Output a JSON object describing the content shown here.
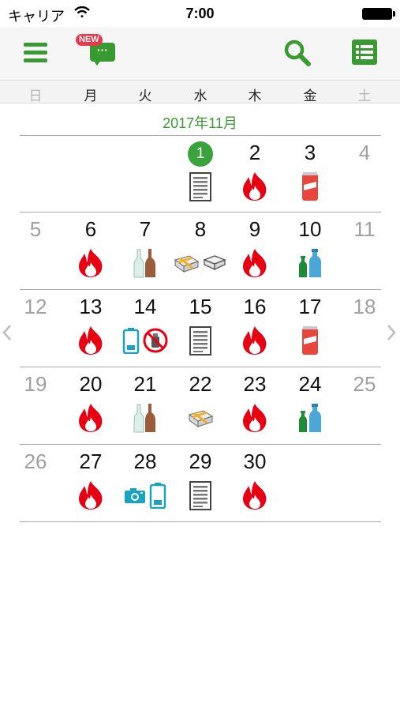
{
  "status_bar": {
    "carrier": "キャリア",
    "time": "7:00"
  },
  "toolbar": {
    "new_badge": "NEW",
    "bubble_text": "···"
  },
  "weekdays": [
    "日",
    "月",
    "火",
    "水",
    "木",
    "金",
    "土"
  ],
  "calendar": {
    "title": "2017年11月",
    "weeks": [
      [
        {
          "d": "",
          "i": []
        },
        {
          "d": "",
          "i": []
        },
        {
          "d": "",
          "i": []
        },
        {
          "d": "1",
          "i": [
            "paper"
          ],
          "today": true
        },
        {
          "d": "2",
          "i": [
            "burnable"
          ]
        },
        {
          "d": "3",
          "i": [
            "can"
          ]
        },
        {
          "d": "4",
          "i": []
        }
      ],
      [
        {
          "d": "5",
          "i": []
        },
        {
          "d": "6",
          "i": [
            "burnable"
          ]
        },
        {
          "d": "7",
          "i": [
            "bottles"
          ]
        },
        {
          "d": "8",
          "i": [
            "newspaper",
            "containers"
          ]
        },
        {
          "d": "9",
          "i": [
            "burnable"
          ]
        },
        {
          "d": "10",
          "i": [
            "pet"
          ]
        },
        {
          "d": "11",
          "i": []
        }
      ],
      [
        {
          "d": "12",
          "i": []
        },
        {
          "d": "13",
          "i": [
            "burnable"
          ]
        },
        {
          "d": "14",
          "i": [
            "battery",
            "no-spray"
          ]
        },
        {
          "d": "15",
          "i": [
            "paper"
          ]
        },
        {
          "d": "16",
          "i": [
            "burnable"
          ]
        },
        {
          "d": "17",
          "i": [
            "can"
          ]
        },
        {
          "d": "18",
          "i": []
        }
      ],
      [
        {
          "d": "19",
          "i": []
        },
        {
          "d": "20",
          "i": [
            "burnable"
          ]
        },
        {
          "d": "21",
          "i": [
            "bottles"
          ]
        },
        {
          "d": "22",
          "i": [
            "newspaper"
          ]
        },
        {
          "d": "23",
          "i": [
            "burnable"
          ]
        },
        {
          "d": "24",
          "i": [
            "pet"
          ]
        },
        {
          "d": "25",
          "i": []
        }
      ],
      [
        {
          "d": "26",
          "i": []
        },
        {
          "d": "27",
          "i": [
            "burnable"
          ]
        },
        {
          "d": "28",
          "i": [
            "camera",
            "battery"
          ]
        },
        {
          "d": "29",
          "i": [
            "paper"
          ]
        },
        {
          "d": "30",
          "i": [
            "burnable"
          ]
        },
        {
          "d": "",
          "i": []
        },
        {
          "d": "",
          "i": []
        }
      ]
    ]
  },
  "icon_names": {
    "burnable": "flame-icon",
    "paper": "paper-bundle-icon",
    "can": "can-icon",
    "bottles": "glass-bottles-icon",
    "newspaper": "newspaper-bundle-icon",
    "containers": "plastic-container-icon",
    "pet": "pet-bottles-icon",
    "battery": "battery-icon",
    "no-spray": "no-spray-can-icon",
    "camera": "camera-icon"
  },
  "colors": {
    "accent": "#3a9a32",
    "burnable": "#e60012",
    "battery": "#1aa3c0"
  }
}
